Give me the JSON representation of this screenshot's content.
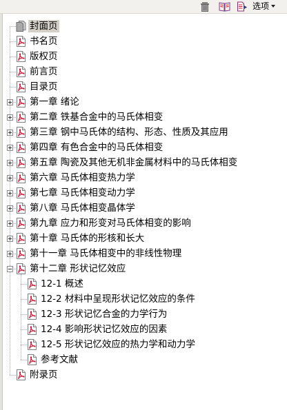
{
  "toolbar": {
    "options_label": "选项"
  },
  "tree": {
    "items": [
      {
        "label": "封面页",
        "level": 0,
        "icon": "page-gray-icon",
        "expander": "none",
        "selected": true
      },
      {
        "label": "书名页",
        "level": 0,
        "icon": "pdf-page-icon",
        "expander": "none"
      },
      {
        "label": "版权页",
        "level": 0,
        "icon": "pdf-page-icon",
        "expander": "none"
      },
      {
        "label": "前言页",
        "level": 0,
        "icon": "pdf-page-icon",
        "expander": "none"
      },
      {
        "label": "目录页",
        "level": 0,
        "icon": "pdf-page-icon",
        "expander": "none"
      },
      {
        "label": "第一章 绪论",
        "level": 0,
        "icon": "pdf-page-icon",
        "expander": "plus"
      },
      {
        "label": "第二章 铁基合金中的马氏体相变",
        "level": 0,
        "icon": "pdf-page-icon",
        "expander": "plus"
      },
      {
        "label": "第三章 钢中马氏体的结构、形态、性质及其应用",
        "level": 0,
        "icon": "pdf-page-icon",
        "expander": "plus"
      },
      {
        "label": "第四章 有色合金中的马氏体相变",
        "level": 0,
        "icon": "pdf-page-icon",
        "expander": "plus"
      },
      {
        "label": "第五章 陶瓷及其他无机非金属材料中的马氏体相变",
        "level": 0,
        "icon": "pdf-page-icon",
        "expander": "plus"
      },
      {
        "label": "第六章 马氏体相变热力学",
        "level": 0,
        "icon": "pdf-page-icon",
        "expander": "plus"
      },
      {
        "label": "第七章 马氏体相变动力学",
        "level": 0,
        "icon": "pdf-page-icon",
        "expander": "plus"
      },
      {
        "label": "第八章 马氏体相变晶体学",
        "level": 0,
        "icon": "pdf-page-icon",
        "expander": "plus"
      },
      {
        "label": "第九章 应力和形变对马氏体相变的影响",
        "level": 0,
        "icon": "pdf-page-icon",
        "expander": "plus"
      },
      {
        "label": "第十章 马氏体的形核和长大",
        "level": 0,
        "icon": "pdf-page-icon",
        "expander": "plus"
      },
      {
        "label": "第十一章 马氏体相变中的非线性物理",
        "level": 0,
        "icon": "pdf-page-icon",
        "expander": "plus"
      },
      {
        "label": "第十二章 形状记忆效应",
        "level": 0,
        "icon": "pdf-page-icon",
        "expander": "minus"
      },
      {
        "label": "12-1 概述",
        "level": 1,
        "icon": "pdf-page-icon",
        "expander": "none"
      },
      {
        "label": "12-2 材料中呈现形状记忆效应的条件",
        "level": 1,
        "icon": "pdf-page-icon",
        "expander": "none"
      },
      {
        "label": "12-3 形状记忆合金的力学行为",
        "level": 1,
        "icon": "pdf-page-icon",
        "expander": "none"
      },
      {
        "label": "12-4 影响形状记忆效应的因素",
        "level": 1,
        "icon": "pdf-page-icon",
        "expander": "none"
      },
      {
        "label": "12-5 形状记忆效应的热力学和动力学",
        "level": 1,
        "icon": "pdf-page-icon",
        "expander": "none"
      },
      {
        "label": "参考文献",
        "level": 1,
        "icon": "pdf-page-icon",
        "expander": "none"
      },
      {
        "label": "附录页",
        "level": 0,
        "icon": "pdf-page-icon",
        "expander": "none"
      }
    ]
  },
  "colors": {
    "pdf_red": "#c8102e",
    "selection": "#d4d0c8"
  }
}
